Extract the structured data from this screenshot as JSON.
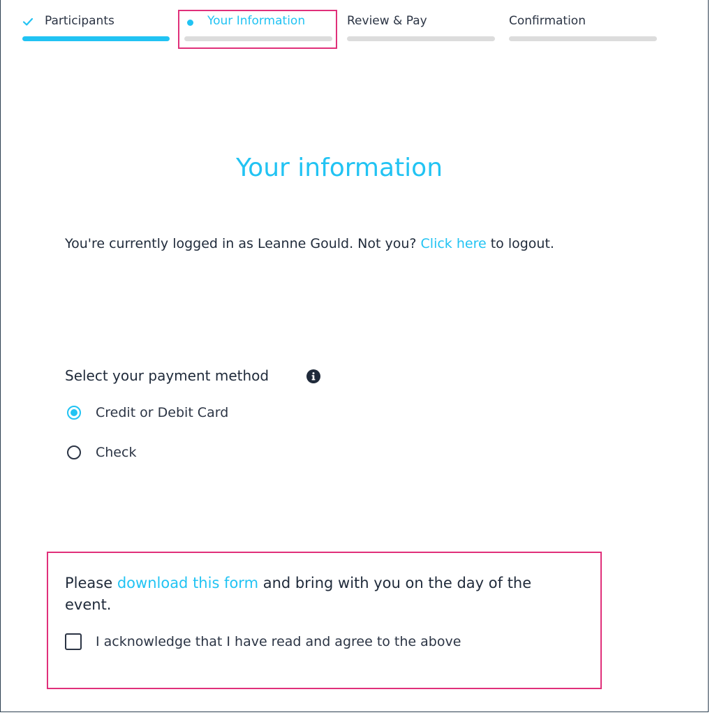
{
  "stepper": {
    "steps": [
      {
        "label": "Participants",
        "state": "complete",
        "icon": "check-icon"
      },
      {
        "label": "Your Information",
        "state": "active",
        "icon": "dot-icon"
      },
      {
        "label": "Review & Pay",
        "state": "upcoming"
      },
      {
        "label": "Confirmation",
        "state": "upcoming"
      }
    ]
  },
  "page": {
    "title": "Your information"
  },
  "login": {
    "prefix": "You're currently logged in as Leanne Gould. Not you?",
    "link": "Click here",
    "suffix": "to logout."
  },
  "payment": {
    "title": "Select your payment method",
    "info_icon": "info-icon",
    "options": [
      {
        "label": "Credit or Debit Card",
        "selected": true
      },
      {
        "label": "Check",
        "selected": false
      }
    ]
  },
  "notice": {
    "prefix": "Please",
    "link": "download this form",
    "suffix": "and bring with you on the day of the event.",
    "acknowledge_label": "I acknowledge that I have read and agree to the above",
    "acknowledged": false
  },
  "colors": {
    "accent": "#21c3f3",
    "highlight": "#e0307a",
    "text": "#1f2a3a",
    "track": "#dcdcdc"
  }
}
